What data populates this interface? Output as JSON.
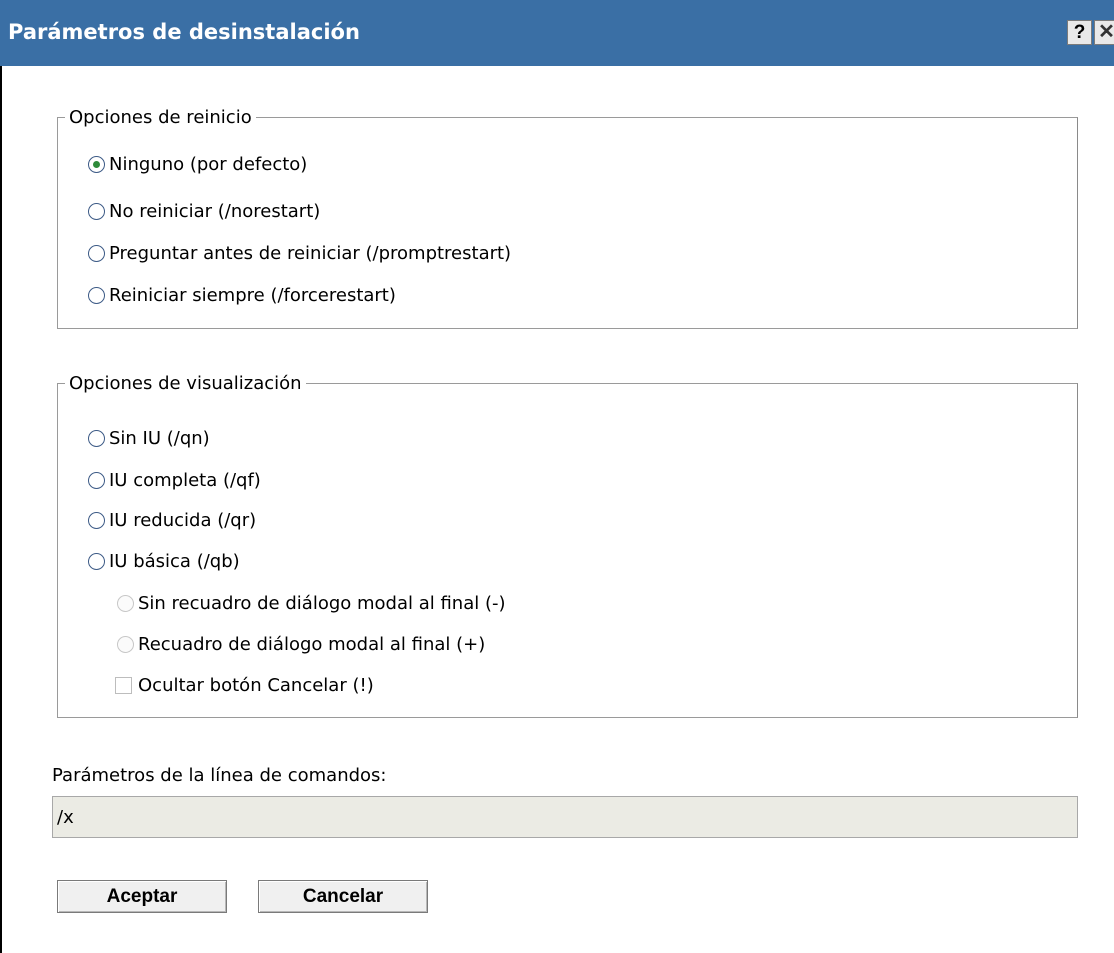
{
  "dialog": {
    "title": "Parámetros de desinstalación",
    "help_label": "?",
    "close_label": "✕"
  },
  "restart_options": {
    "legend": "Opciones de reinicio",
    "items": [
      {
        "label": "Ninguno (por defecto)",
        "checked": true
      },
      {
        "label": "No reiniciar (/norestart)",
        "checked": false
      },
      {
        "label": "Preguntar antes de reiniciar (/promptrestart)",
        "checked": false
      },
      {
        "label": "Reiniciar siempre (/forcerestart)",
        "checked": false
      }
    ]
  },
  "display_options": {
    "legend": "Opciones de visualización",
    "items": [
      {
        "label": "Sin IU (/qn)",
        "checked": false
      },
      {
        "label": "IU completa (/qf)",
        "checked": false
      },
      {
        "label": "IU reducida (/qr)",
        "checked": false
      },
      {
        "label": "IU básica (/qb)",
        "checked": false
      }
    ],
    "sub_items": [
      {
        "label": "Sin recuadro de diálogo modal al final (-)",
        "disabled": true
      },
      {
        "label": "Recuadro de diálogo modal al final (+)",
        "disabled": true
      }
    ],
    "hide_cancel_label": "Ocultar botón Cancelar (!)"
  },
  "command_line": {
    "label": "Parámetros de la línea de comandos:",
    "value": "/x"
  },
  "buttons": {
    "ok": "Aceptar",
    "cancel": "Cancelar"
  },
  "colors": {
    "titlebar": "#3a6fa5",
    "radio_selected": "#2e8b3a",
    "input_bg": "#ebebe4"
  }
}
